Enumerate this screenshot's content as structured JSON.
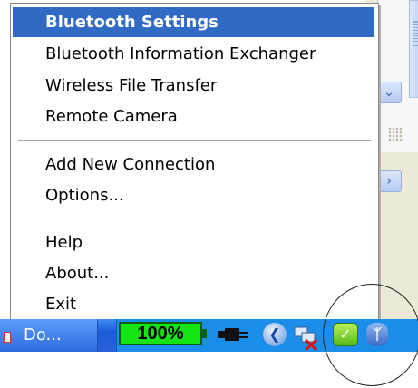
{
  "menu": {
    "items": [
      {
        "label": "Bluetooth Settings",
        "highlighted": true
      },
      {
        "label": "Bluetooth Information Exchanger"
      },
      {
        "label": "Wireless File Transfer"
      },
      {
        "label": "Remote Camera"
      },
      {
        "label": "Add New Connection"
      },
      {
        "label": "Options..."
      },
      {
        "label": "Help"
      },
      {
        "label": "About..."
      },
      {
        "label": "Exit"
      }
    ]
  },
  "taskbar": {
    "task_button_label": "Do...",
    "battery_percent": "100%"
  },
  "tray_icons": [
    "back-arrow-icon",
    "network-disconnected-icon",
    "security-shield-icon",
    "bluetooth-icon"
  ],
  "colors": {
    "highlight": "#316ac5",
    "taskbar": "#2a63d9",
    "tray": "#1a8ee8",
    "battery": "#14e414"
  }
}
